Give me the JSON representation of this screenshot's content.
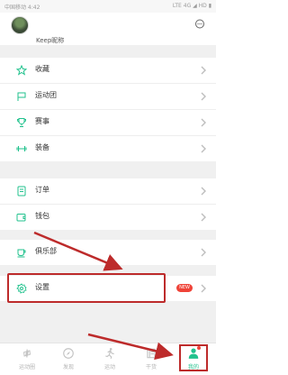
{
  "statusbar": {
    "left": "中国移动 4:42",
    "right": "LTE 4G ◢ HD ▮"
  },
  "header": {
    "username": "Keep昵称",
    "avatar_icon": "user-avatar-photo",
    "chat_icon": "chat-bubble-icon"
  },
  "menu": {
    "section1": [
      {
        "label": "收藏",
        "icon": "star-icon"
      },
      {
        "label": "运动团",
        "icon": "flag-icon"
      },
      {
        "label": "赛事",
        "icon": "trophy-icon"
      },
      {
        "label": "装备",
        "icon": "dumbbell-icon"
      }
    ],
    "section2": [
      {
        "label": "订单",
        "icon": "document-icon"
      },
      {
        "label": "钱包",
        "icon": "wallet-icon"
      }
    ],
    "section3": [
      {
        "label": "俱乐部",
        "icon": "cup-icon"
      }
    ],
    "section4": [
      {
        "label": "设置",
        "icon": "gear-icon",
        "badge": "NEW"
      }
    ]
  },
  "tabbar": [
    {
      "label": "运动圈",
      "icon": "circle-icon"
    },
    {
      "label": "发现",
      "icon": "compass-icon"
    },
    {
      "label": "运动",
      "icon": "run-icon"
    },
    {
      "label": "干货",
      "icon": "knowledge-icon"
    },
    {
      "label": "我的",
      "icon": "person-icon",
      "active": true
    }
  ],
  "colors": {
    "accent": "#21c28d",
    "annotation": "#bd2b2b",
    "badge": "#ef4338"
  }
}
